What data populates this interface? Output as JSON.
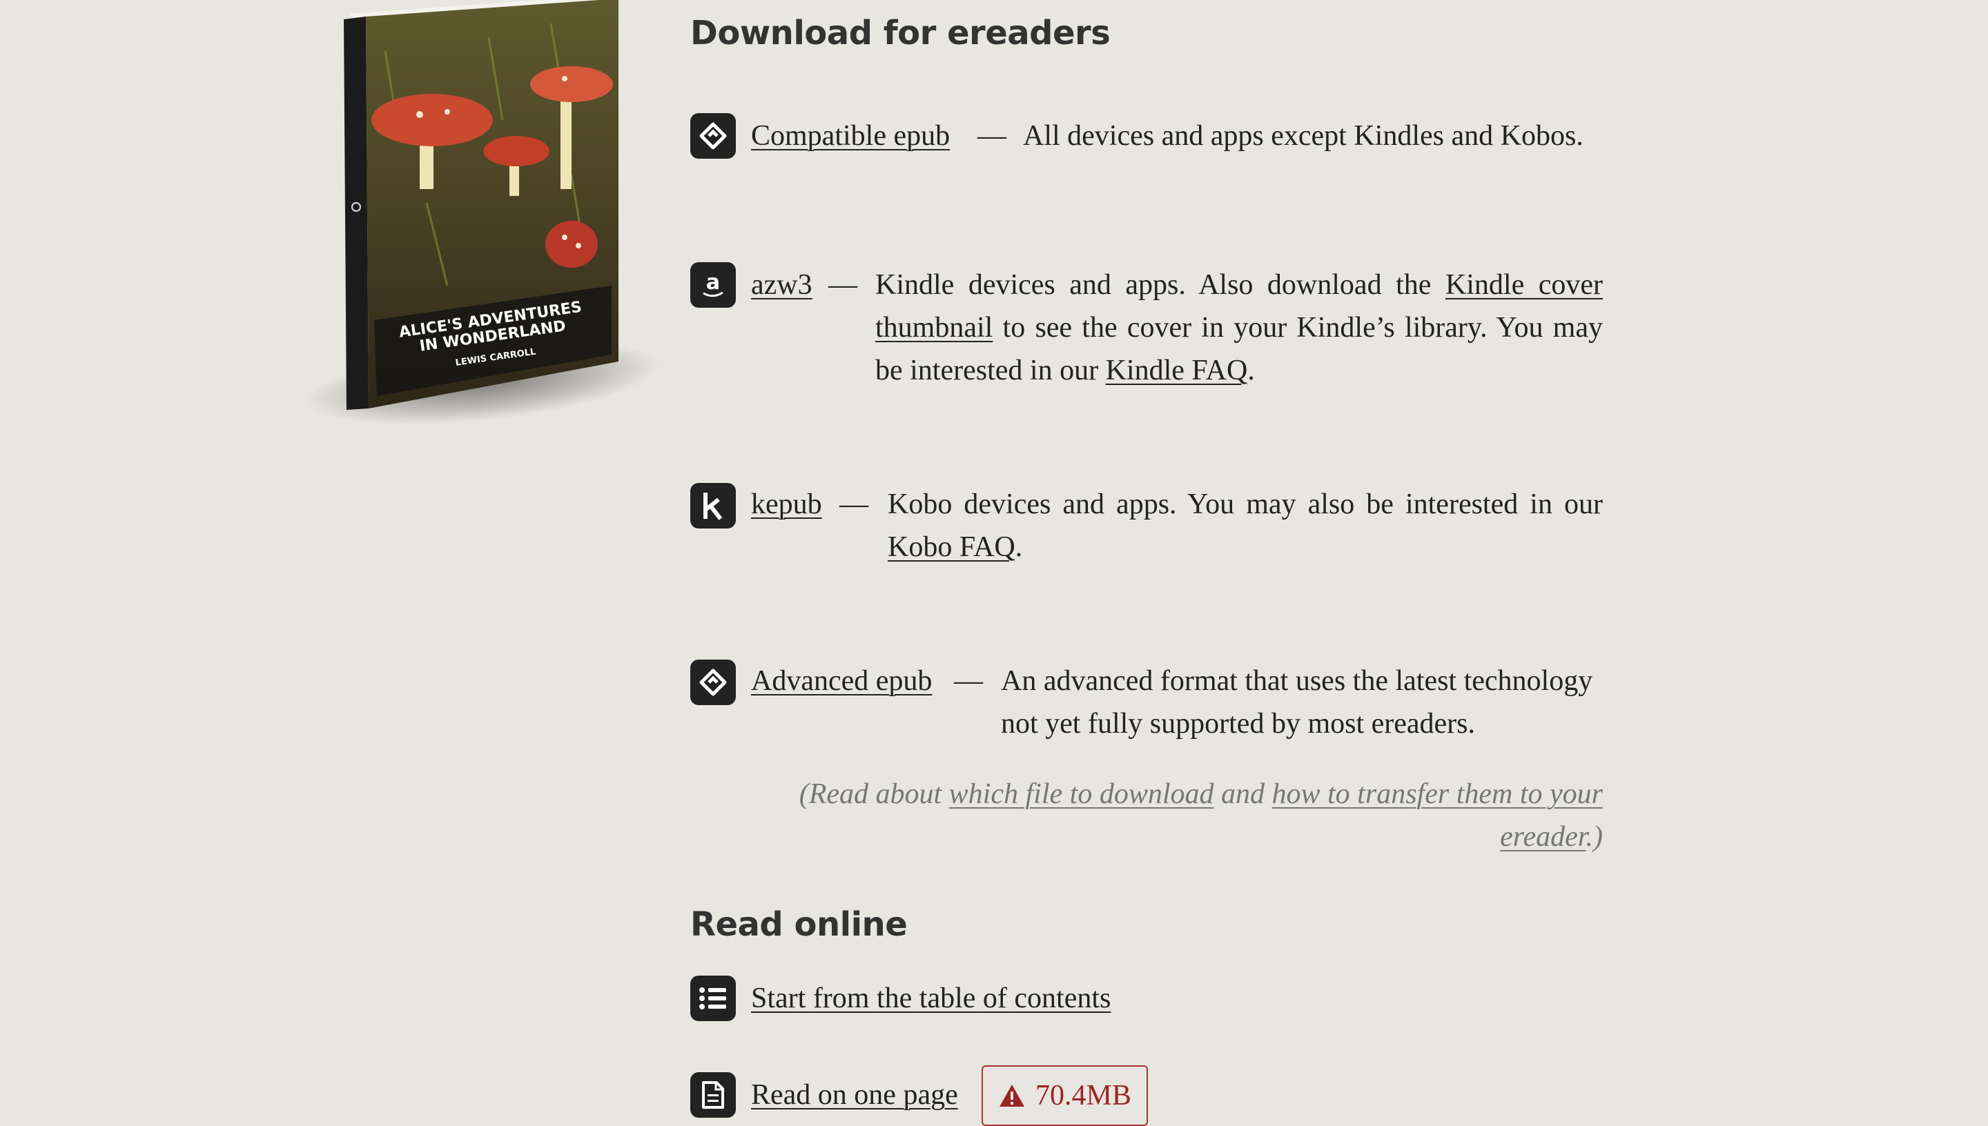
{
  "book": {
    "title_line1": "ALICE'S ADVENTURES",
    "title_line2": "IN WONDERLAND",
    "author": "LEWIS CARROLL"
  },
  "downloads": {
    "heading": "Download for ereaders",
    "items": [
      {
        "icon": "epub-icon",
        "label": "Compatible epub",
        "dash": "—",
        "desc": "All devices and apps except Kindles and Kobos."
      },
      {
        "icon": "amazon-icon",
        "label": "azw3",
        "dash": "—",
        "desc_parts": {
          "t1": "Kindle devices and apps. Also download the ",
          "link1": "Kindle cover thumbnail",
          "t2": " to see the cover in your Kindle’s library. You may be interested in our ",
          "link2": "Kindle FAQ",
          "t3": "."
        }
      },
      {
        "icon": "kobo-icon",
        "label": "kepub",
        "dash": "—",
        "desc_parts": {
          "t1": "Kobo devices and apps. You may also be interested in our ",
          "link1": "Kobo FAQ",
          "t2": "."
        }
      },
      {
        "icon": "epub-icon",
        "label": "Advanced epub",
        "dash": "—",
        "desc": "An advanced format that uses the latest technol­ogy not yet fully supported by most ereaders."
      }
    ],
    "note": {
      "t1": "(Read about ",
      "link1": "which file to download",
      "t2": " and ",
      "link2": "how to transfer them to your ereader",
      "t3": ".)"
    }
  },
  "read_online": {
    "heading": "Read online",
    "toc_label": "Start from the table of contents",
    "one_page_label": "Read on one page",
    "size_warning": "70.4MB"
  },
  "colors": {
    "background": "#e8e6e0",
    "text": "#222222",
    "warning": "#9b2424"
  }
}
